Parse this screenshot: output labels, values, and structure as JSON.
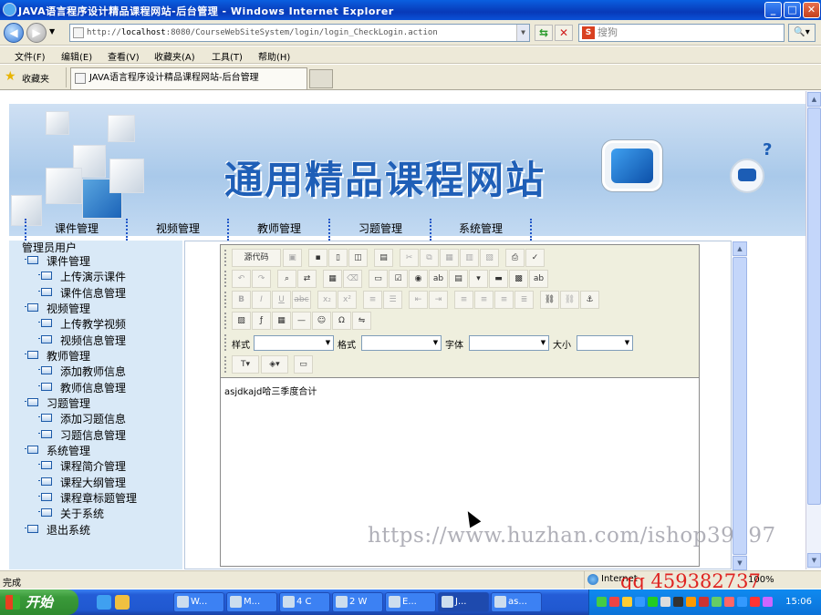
{
  "window": {
    "title": "JAVA语言程序设计精品课程网站-后台管理 - Windows Internet Explorer",
    "minimize": "_",
    "maximize": "□",
    "close": "✕"
  },
  "address_bar": {
    "url_prefix": "http://",
    "url_host": "localhost",
    "url_rest": ":8080/CourseWebSiteSystem/login/login_CheckLogin.action",
    "search_placeholder": "搜狗",
    "search_logo": "S"
  },
  "menu": [
    "文件(F)",
    "编辑(E)",
    "查看(V)",
    "收藏夹(A)",
    "工具(T)",
    "帮助(H)"
  ],
  "favorites": {
    "label": "收藏夹",
    "tab_title": "JAVA语言程序设计精品课程网站-后台管理"
  },
  "banner": {
    "site_title": "通用精品课程网站",
    "question_mark": "?"
  },
  "topnav": [
    "课件管理",
    "视频管理",
    "教师管理",
    "习题管理",
    "系统管理"
  ],
  "sidebar": {
    "root": "管理员用户",
    "tree": [
      {
        "label": "课件管理",
        "level": 1
      },
      {
        "label": "上传演示课件",
        "level": 2
      },
      {
        "label": "课件信息管理",
        "level": 2
      },
      {
        "label": "视频管理",
        "level": 1
      },
      {
        "label": "上传教学视频",
        "level": 2
      },
      {
        "label": "视频信息管理",
        "level": 2
      },
      {
        "label": "教师管理",
        "level": 1
      },
      {
        "label": "添加教师信息",
        "level": 2
      },
      {
        "label": "教师信息管理",
        "level": 2
      },
      {
        "label": "习题管理",
        "level": 1
      },
      {
        "label": "添加习题信息",
        "level": 2
      },
      {
        "label": "习题信息管理",
        "level": 2
      },
      {
        "label": "系统管理",
        "level": 1
      },
      {
        "label": "课程简介管理",
        "level": 2
      },
      {
        "label": "课程大纲管理",
        "level": 2
      },
      {
        "label": "课程章标题管理",
        "level": 2
      },
      {
        "label": "关于系统",
        "level": 2
      },
      {
        "label": "退出系统",
        "level": 1
      }
    ]
  },
  "editor": {
    "source_button": "源代码",
    "style_label": "样式",
    "format_label": "格式",
    "font_label": "字体",
    "size_label": "大小",
    "content": "asjdkajd哈三季度合计"
  },
  "watermark": "https://www.huzhan.com/ishop39397",
  "statusbar": {
    "status": "完成",
    "zone": "Internet",
    "zoom": "100%"
  },
  "overlay_qq": "qq 459382737",
  "taskbar": {
    "start": "开始",
    "tasks": [
      "W...",
      "M...",
      "4 C",
      "2 W",
      "E...",
      "J...",
      "as..."
    ],
    "clock": "15:06"
  }
}
